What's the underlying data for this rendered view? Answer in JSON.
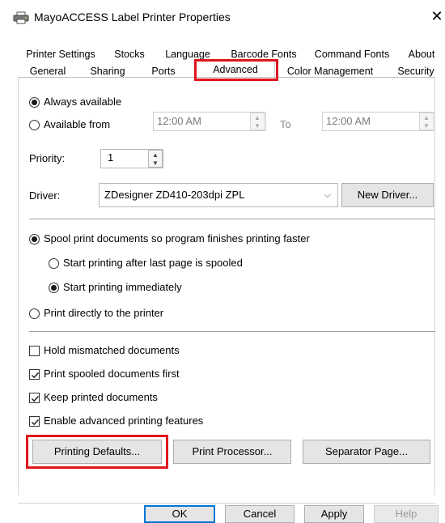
{
  "window": {
    "title": "MayoACCESS Label Printer Properties",
    "close_glyph": "✕",
    "icon": "printer-icon"
  },
  "tabs_row1": [
    "Printer Settings",
    "Stocks",
    "Language",
    "Barcode Fonts",
    "Command Fonts",
    "About"
  ],
  "tabs_row2": [
    "General",
    "Sharing",
    "Ports",
    "Advanced",
    "Color Management",
    "Security"
  ],
  "active_tab": "Advanced",
  "availability": {
    "always_label": "Always available",
    "from_label": "Available from",
    "always_selected": true,
    "from_time": "12:00 AM",
    "to_label": "To",
    "to_time": "12:00 AM"
  },
  "priority": {
    "label": "Priority:",
    "value": "1"
  },
  "driver": {
    "label": "Driver:",
    "value": "ZDesigner ZD410-203dpi ZPL",
    "new_driver_label": "New Driver..."
  },
  "spool": {
    "spool_label": "Spool print documents so program finishes printing faster",
    "after_last_label": "Start printing after last page is spooled",
    "immediately_label": "Start printing immediately",
    "direct_label": "Print directly to the printer"
  },
  "checks": {
    "hold_label": "Hold mismatched documents",
    "hold_checked": false,
    "spooled_first_label": "Print spooled documents first",
    "spooled_first_checked": true,
    "keep_label": "Keep printed documents",
    "keep_checked": true,
    "advanced_label": "Enable advanced printing features",
    "advanced_checked": true
  },
  "buttons": {
    "printing_defaults": "Printing Defaults...",
    "print_processor": "Print Processor...",
    "separator_page": "Separator Page..."
  },
  "footer": {
    "ok": "OK",
    "cancel": "Cancel",
    "apply": "Apply",
    "help": "Help"
  },
  "colors": {
    "highlight": "#e0151d",
    "default_button_border": "#0078d7"
  }
}
